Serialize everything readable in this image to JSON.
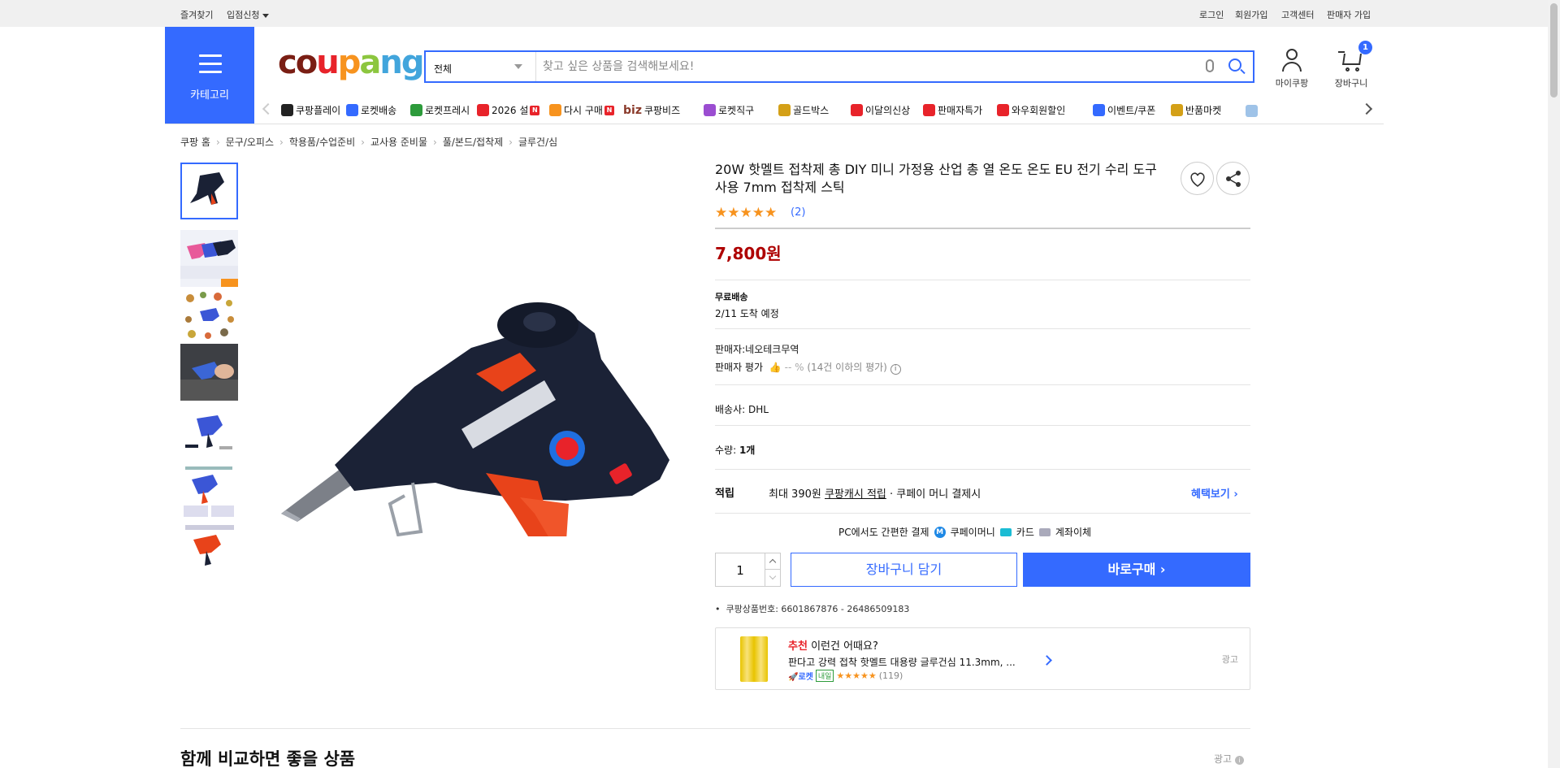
{
  "topbar": {
    "favorites": "즐겨찾기",
    "store_apply": "입점신청",
    "login": "로그인",
    "signup": "회원가입",
    "customer_center": "고객센터",
    "seller_signup": "판매자 가입"
  },
  "header": {
    "category_label": "카테고리",
    "logo": "coupang",
    "search": {
      "category_value": "전체",
      "placeholder": "찾고 싶은 상품을 검색해보세요!"
    },
    "mypage_label": "마이쿠팡",
    "cart_label": "장바구니",
    "cart_count": "1"
  },
  "service_nav": [
    {
      "label": "쿠팡플레이",
      "icon": "play-icon",
      "color": "#222222"
    },
    {
      "label": "로켓배송",
      "icon": "rocket-icon",
      "color": "#346aff"
    },
    {
      "label": "로켓프레시",
      "icon": "rocket-fresh-icon",
      "color": "#2d9b3b"
    },
    {
      "label": "2026 설",
      "icon": "gift-icon",
      "color": "#e8232a",
      "new": "N"
    },
    {
      "label": "다시 구매",
      "icon": "home-icon",
      "color": "#f7931e",
      "new": "N"
    },
    {
      "label": "쿠팡비즈",
      "icon": "biz-icon",
      "prefix": "biz",
      "color": "#8a3a2a"
    },
    {
      "label": "로켓직구",
      "icon": "global-icon",
      "color": "#9b4dd1"
    },
    {
      "label": "골드박스",
      "icon": "goldbox-icon",
      "color": "#d4a017"
    },
    {
      "label": "이달의신상",
      "icon": "new-bag-icon",
      "color": "#e8232a"
    },
    {
      "label": "판매자특가",
      "icon": "percent-icon",
      "color": "#e8232a"
    },
    {
      "label": "와우회원할인",
      "icon": "wow-icon",
      "color": "#e8232a"
    },
    {
      "label": "이벤트/쿠폰",
      "icon": "coupon-icon",
      "color": "#346aff"
    },
    {
      "label": "반품마켓",
      "icon": "market-icon",
      "color": "#d4a017"
    }
  ],
  "breadcrumb": [
    "쿠팡 홈",
    "문구/오피스",
    "학용품/수업준비",
    "교사용 준비물",
    "풀/본드/접착제",
    "글루건/심"
  ],
  "product": {
    "title": "20W 핫멜트 접착제 총 DIY 미니 가정용 산업 총 열 온도 온도 EU 전기 수리 도구 사용 7mm 접착제 스틱",
    "rating_stars": 5,
    "review_count": "(2)",
    "price": "7,800원",
    "shipping_label": "무료배송",
    "arrival": "2/11 도착 예정",
    "seller": "판매자:네오테크무역",
    "seller_rating_label": "판매자 평가",
    "seller_rating_value": "-- %",
    "seller_rating_note": "(14건 이하의 평가)",
    "carrier": "배송사:  DHL",
    "quantity_label": "수량:",
    "quantity_value": "1개",
    "benefit_label": "적립",
    "benefit_text_1": "최대 390원",
    "benefit_link": "쿠팡캐시 적립",
    "benefit_text_2": "· 쿠페이 머니 결제시",
    "benefit_more": "혜택보기",
    "pc_pay_label": "PC에서도 간편한 결제",
    "pay_methods": [
      "쿠페이머니",
      "카드",
      "계좌이체"
    ],
    "qty_input": "1",
    "add_to_cart": "장바구니 담기",
    "buy_now": "바로구매",
    "product_no": "쿠팡상품번호: 6601867876 - 26486509183"
  },
  "recommendation": {
    "highlight": "추천",
    "title": "이런건 어때요?",
    "desc": "판다고 강력 접착 핫멜트 대용량 글루건심 11.3mm, ...",
    "rocket": "로켓",
    "tomorrow": "내일",
    "review_count": "(119)",
    "ad": "광고"
  },
  "compare": {
    "title": "함께 비교하면 좋을 상품",
    "ad": "광고"
  },
  "colors": {
    "accent": "#346aff",
    "price": "#ae0000",
    "star": "#f7931e"
  }
}
